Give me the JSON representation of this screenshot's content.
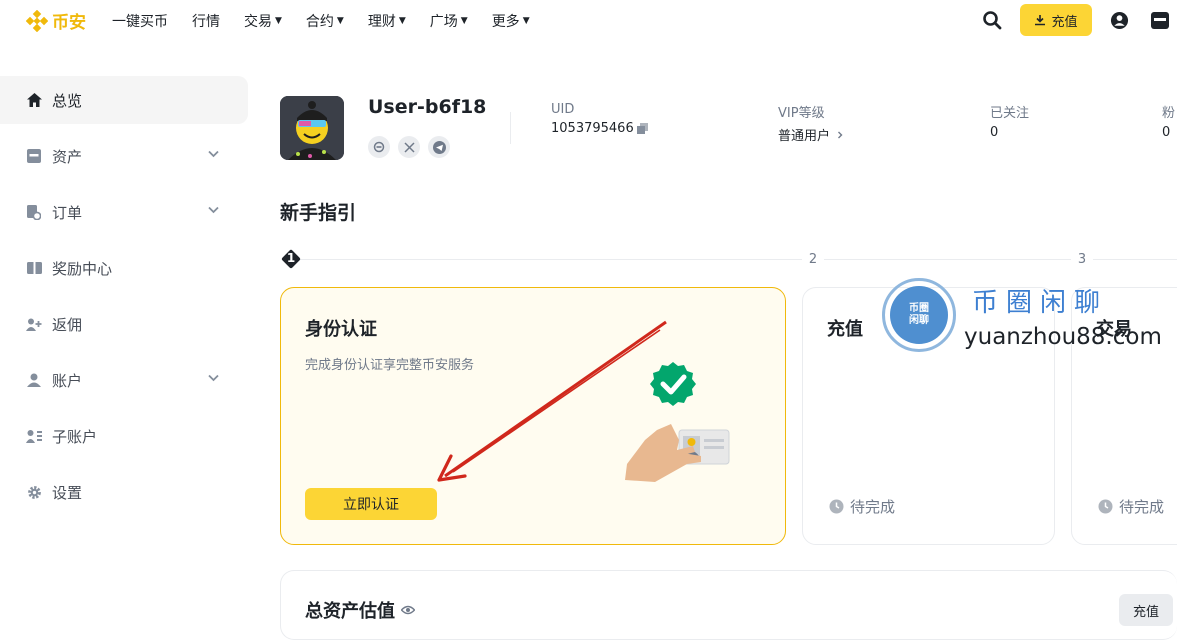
{
  "topbar": {
    "logo_text": "币安",
    "nav": [
      {
        "label": "一键买币",
        "has_caret": false
      },
      {
        "label": "行情",
        "has_caret": false
      },
      {
        "label": "交易",
        "has_caret": true
      },
      {
        "label": "合约",
        "has_caret": true
      },
      {
        "label": "理财",
        "has_caret": true
      },
      {
        "label": "广场",
        "has_caret": true
      },
      {
        "label": "更多",
        "has_caret": true
      }
    ],
    "deposit_label": "充值",
    "icons": [
      "search-icon",
      "download-icon",
      "user-icon",
      "wallet-icon"
    ]
  },
  "sidebar": {
    "items": [
      {
        "label": "总览",
        "icon": "home-icon",
        "active": true,
        "expandable": false
      },
      {
        "label": "资产",
        "icon": "wallet-icon",
        "active": false,
        "expandable": true
      },
      {
        "label": "订单",
        "icon": "orders-icon",
        "active": false,
        "expandable": true
      },
      {
        "label": "奖励中心",
        "icon": "rewards-icon",
        "active": false,
        "expandable": false
      },
      {
        "label": "返佣",
        "icon": "add-user-icon",
        "active": false,
        "expandable": false
      },
      {
        "label": "账户",
        "icon": "account-icon",
        "active": false,
        "expandable": true
      },
      {
        "label": "子账户",
        "icon": "sub-account-icon",
        "active": false,
        "expandable": false
      },
      {
        "label": "设置",
        "icon": "gear-icon",
        "active": false,
        "expandable": false
      }
    ]
  },
  "profile": {
    "username": "User-b6f18",
    "uid_label": "UID",
    "uid_value": "1053795466",
    "vip_label": "VIP等级",
    "vip_value": "普通用户",
    "following_label": "已关注",
    "following_value": "0",
    "followers_label": "粉",
    "followers_value": "0"
  },
  "guide": {
    "title": "新手指引",
    "steps": [
      "1",
      "2",
      "3"
    ],
    "cards": [
      {
        "title": "身份认证",
        "desc": "完成身份认证享完整币安服务",
        "button": "立即认证"
      },
      {
        "title": "充值",
        "status": "待完成"
      },
      {
        "title": "交易",
        "status": "待完成"
      }
    ]
  },
  "watermark": {
    "badge_text": "币圈\n闲聊",
    "title": "币圈闲聊",
    "url": "yuanzhou88.com"
  },
  "assets": {
    "title": "总资产估值",
    "deposit_label": "充值"
  },
  "colors": {
    "brand_yellow": "#fcd535",
    "logo_gold": "#f0b90b",
    "text_primary": "#1e2329",
    "text_secondary": "#707a8a",
    "success_green": "#03a66d",
    "arrow_red": "#d0281c"
  }
}
